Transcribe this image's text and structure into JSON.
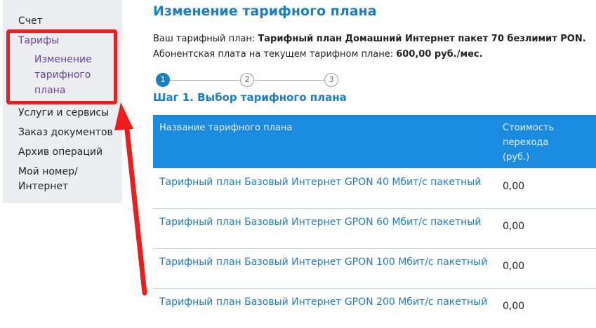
{
  "sidebar": {
    "items": [
      {
        "label": "Счет"
      },
      {
        "label": "Тарифы"
      },
      {
        "label": "Изменение тарифного плана"
      },
      {
        "label": "Услуги и сервисы"
      },
      {
        "label": "Заказ документов"
      },
      {
        "label": "Архив операций"
      },
      {
        "label": "Мой номер/Интернет"
      }
    ]
  },
  "main": {
    "title": "Изменение тарифного плана",
    "current_plan_label": "Ваш тарифный план: ",
    "current_plan_value": "Тарифный план Домашний Интернет пакет 70 безлимит PON.",
    "fee_label": "Абонентская плата на текущем тарифном плане: ",
    "fee_value": "600,00 руб./мес.",
    "steps": [
      "1",
      "2",
      "3"
    ],
    "active_step": 1,
    "step_title": "Шаг 1. Выбор тарифного плана",
    "table": {
      "headers": [
        "Название тарифного плана",
        "Стоимость перехода (руб.)"
      ],
      "rows": [
        {
          "name": "Тарифный план Базовый Интернет GPON 40 Мбит/с пакетный",
          "price": "0,00"
        },
        {
          "name": "Тарифный план Базовый Интернет GPON 60 Мбит/с пакетный",
          "price": "0,00"
        },
        {
          "name": "Тарифный план Базовый Интернет GPON 100 Мбит/с пакетный",
          "price": "0,00"
        },
        {
          "name": "Тарифный план Базовый Интернет GPON 200 Мбит/с пакетный",
          "price": "0,00"
        }
      ]
    }
  },
  "colors": {
    "accent": "#1a7ec7",
    "header_bg": "#1a8bdf",
    "highlight": "#f01c1c",
    "active_menu": "#6b3fa0"
  },
  "icons": [
    "red-arrow-annotation-icon"
  ]
}
